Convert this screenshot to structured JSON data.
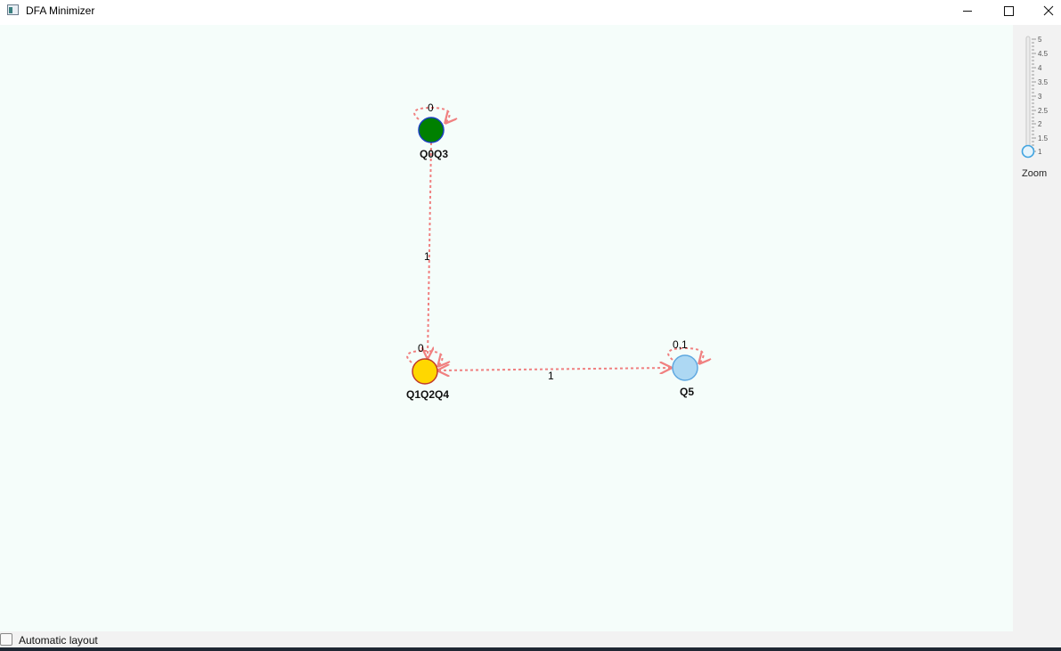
{
  "window": {
    "title": "DFA Minimizer",
    "minimize_icon": "minimize-icon",
    "maximize_icon": "maximize-icon",
    "close_icon": "close-icon"
  },
  "graph": {
    "states": [
      {
        "label": "Q0Q3",
        "fill": "#008000",
        "stroke": "#1a3fbf"
      },
      {
        "label": "Q1Q2Q4",
        "fill": "#ffd700",
        "stroke": "#c0392b"
      },
      {
        "label": "Q5",
        "fill": "#add8f3",
        "stroke": "#5fa8e0"
      }
    ],
    "self_loops": [
      {
        "state": "Q0Q3",
        "label": "0"
      },
      {
        "state": "Q1Q2Q4",
        "label": "0"
      },
      {
        "state": "Q5",
        "label": "0,1"
      }
    ],
    "edges": [
      {
        "from": "Q0Q3",
        "to": "Q1Q2Q4",
        "label": "1"
      },
      {
        "from": "Q1Q2Q4",
        "to": "Q5",
        "label": "1"
      }
    ],
    "edge_color": "#f08080"
  },
  "zoom": {
    "label": "Zoom",
    "min": 1,
    "max": 5,
    "value": 1,
    "ticks": [
      "5",
      "4.5",
      "4",
      "3.5",
      "3",
      "2.5",
      "2",
      "1.5",
      "1"
    ]
  },
  "footer": {
    "automatic_layout_label": "Automatic layout",
    "automatic_layout_checked": false
  }
}
